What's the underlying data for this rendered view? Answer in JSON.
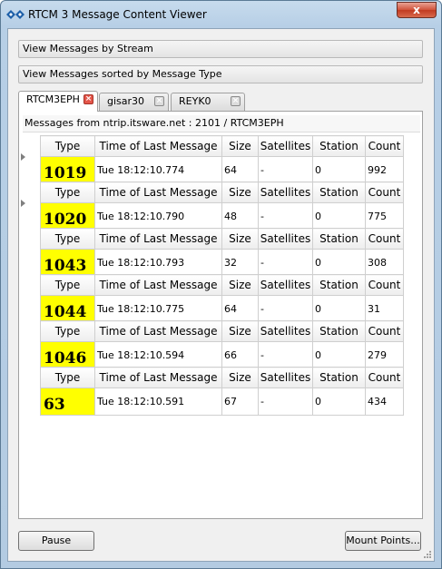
{
  "window": {
    "title": "RTCM 3 Message Content Viewer",
    "close_label": "x"
  },
  "stream_bar": {
    "label": "View Messages by Stream"
  },
  "type_bar": {
    "label": "View Messages sorted by Message Type"
  },
  "tabs": [
    {
      "label": "RTCM3EPH",
      "active": true
    },
    {
      "label": "gisar30",
      "active": false
    },
    {
      "label": "REYK0",
      "active": false
    }
  ],
  "panel": {
    "header": "Messages from ntrip.itsware.net : 2101 / RTCM3EPH"
  },
  "columns": [
    "Type",
    "Time of Last Message",
    "Size",
    "Satellites",
    "Station",
    "Count"
  ],
  "messages": [
    {
      "type": "1019",
      "time": "Tue 18:12:10.774",
      "size": "64",
      "satellites": "-",
      "station": "0",
      "count": "992",
      "expandable": true
    },
    {
      "type": "1020",
      "time": "Tue 18:12:10.790",
      "size": "48",
      "satellites": "-",
      "station": "0",
      "count": "775",
      "expandable": true
    },
    {
      "type": "1043",
      "time": "Tue 18:12:10.793",
      "size": "32",
      "satellites": "-",
      "station": "0",
      "count": "308",
      "expandable": false
    },
    {
      "type": "1044",
      "time": "Tue 18:12:10.775",
      "size": "64",
      "satellites": "-",
      "station": "0",
      "count": "31",
      "expandable": false
    },
    {
      "type": "1046",
      "time": "Tue 18:12:10.594",
      "size": "66",
      "satellites": "-",
      "station": "0",
      "count": "279",
      "expandable": false
    },
    {
      "type": "63",
      "time": "Tue 18:12:10.591",
      "size": "67",
      "satellites": "-",
      "station": "0",
      "count": "434",
      "expandable": false
    }
  ],
  "buttons": {
    "pause": "Pause",
    "mount_points": "Mount Points..."
  },
  "colors": {
    "type_highlight": "#ffff00",
    "close_tab_active": "#e4564a"
  }
}
